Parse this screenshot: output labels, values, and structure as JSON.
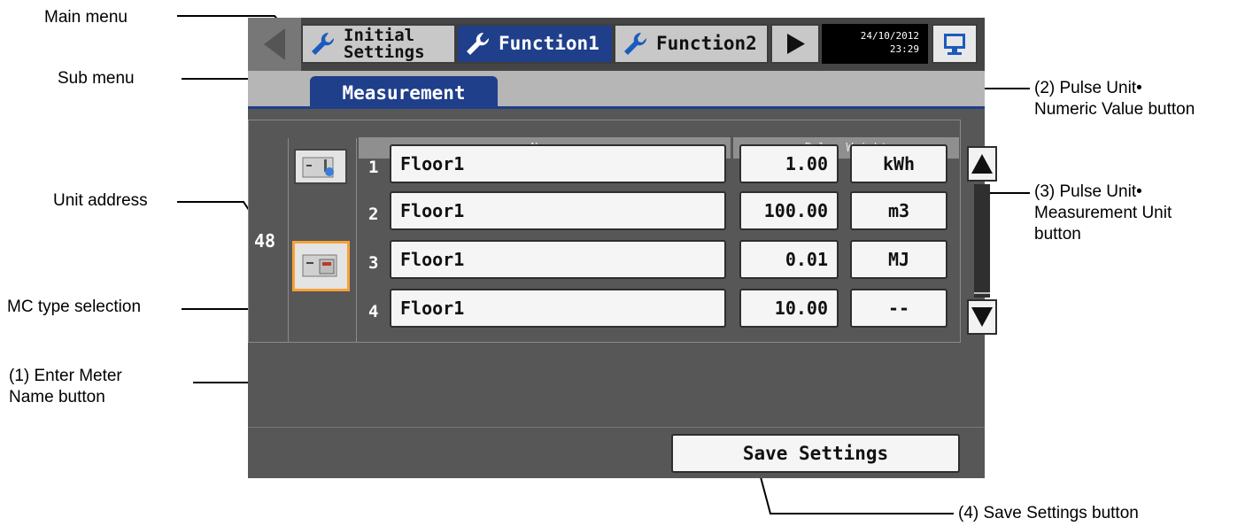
{
  "callouts": {
    "main_menu": "Main menu",
    "sub_menu": "Sub menu",
    "unit_address": "Unit address",
    "mc_type_selection": "MC type selection",
    "enter_meter_name_1": "(1) Enter Meter",
    "enter_meter_name_2": "Name button",
    "pulse_numeric_1": "(2) Pulse Unit•",
    "pulse_numeric_2": "Numeric Value button",
    "pulse_unit_1": "(3) Pulse Unit•",
    "pulse_unit_2": "Measurement Unit",
    "pulse_unit_3": "button",
    "save_settings": "(4) Save Settings button"
  },
  "header": {
    "tabs": [
      {
        "label_line1": "Initial",
        "label_line2": "Settings",
        "icon": "wrench-icon",
        "active": false
      },
      {
        "label": "Function1",
        "icon": "wrench-icon",
        "active": true
      },
      {
        "label": "Function2",
        "icon": "wrench-icon",
        "active": false
      }
    ],
    "date": "24/10/2012",
    "time": "23:29"
  },
  "submenu": {
    "tab": "Measurement"
  },
  "table": {
    "headers": {
      "name": "Name",
      "pulse_weight": "Pulse Weight"
    },
    "unit_address": "48",
    "rows": [
      {
        "no": "1",
        "name": "Floor1",
        "value": "1.00",
        "unit": "kWh"
      },
      {
        "no": "2",
        "name": "Floor1",
        "value": "100.00",
        "unit": "m3"
      },
      {
        "no": "3",
        "name": "Floor1",
        "value": "0.01",
        "unit": "MJ"
      },
      {
        "no": "4",
        "name": "Floor1",
        "value": "10.00",
        "unit": "--"
      }
    ]
  },
  "footer": {
    "save_label": "Save Settings"
  },
  "colors": {
    "active_tab": "#1f3f8a",
    "selection": "#f5a23a",
    "screen_bg": "#575757"
  }
}
